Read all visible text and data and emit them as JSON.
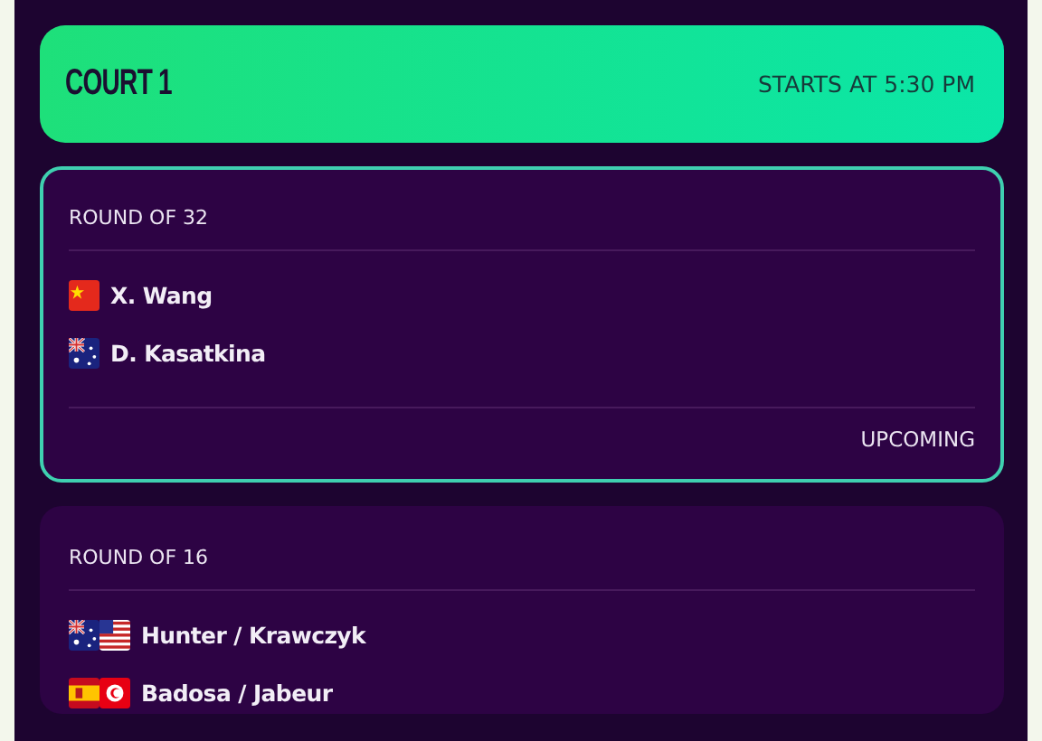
{
  "court": {
    "title": "COURT 1",
    "start": "STARTS AT 5:30 PM"
  },
  "matches": [
    {
      "round": "ROUND OF 32",
      "selected": true,
      "players": [
        {
          "name": "X. Wang",
          "flags": [
            {
              "kind": "cn"
            }
          ]
        },
        {
          "name": "D. Kasatkina",
          "flags": [
            {
              "kind": "au"
            }
          ]
        }
      ],
      "status": "UPCOMING"
    },
    {
      "round": "ROUND OF 16",
      "selected": false,
      "players": [
        {
          "name": "Hunter / Krawczyk",
          "flags": [
            {
              "kind": "au"
            },
            {
              "kind": "us"
            }
          ]
        },
        {
          "name": "Badosa / Jabeur",
          "flags": [
            {
              "kind": "es"
            },
            {
              "kind": "tn"
            }
          ]
        }
      ]
    }
  ]
}
